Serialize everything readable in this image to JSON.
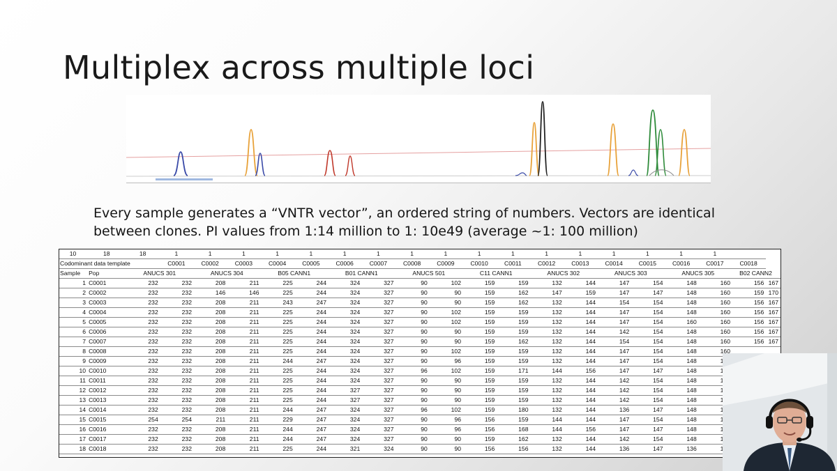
{
  "slide": {
    "title": "Multiplex across multiple loci",
    "text_line1": "Every sample generates a “VNTR vector”, an ordered string of numbers. Vectors are identical",
    "text_line2": "between clones. PI values from 1:14 million to 1: 10e49 (average ~1: 100 million)"
  },
  "electropherogram": {
    "peak_colors": {
      "blue": "#3a4aa8",
      "orange": "#e8a23a",
      "red": "#c0392b",
      "black": "#222222",
      "green": "#2e8b3a"
    }
  },
  "spreadsheet": {
    "row1": [
      "10",
      "18",
      "18",
      "1",
      "1",
      "1",
      "1",
      "1",
      "1",
      "1",
      "1",
      "1",
      "1",
      "1",
      "1",
      "1",
      "1",
      "1",
      "1",
      "1"
    ],
    "template_label": "Codominant data template",
    "template_codes": [
      "C0001",
      "C0002",
      "C0003",
      "C0004",
      "C0005",
      "C0006",
      "C0007",
      "C0008",
      "C0009",
      "C0010",
      "C0011",
      "C0012",
      "C0013",
      "C0014",
      "C0015",
      "C0016",
      "C0017",
      "C0018"
    ],
    "header": {
      "sample": "Sample",
      "pop": "Pop",
      "loci": [
        "ANUCS 301",
        "ANUCS 304",
        "B05 CANN1",
        "B01 CANN1",
        "ANUCS 501",
        "C11 CANN1",
        "ANUCS 302",
        "ANUCS 303",
        "ANUCS 305",
        "B02 CANN2"
      ]
    },
    "rows": [
      {
        "sample": "1",
        "pop": "C0001",
        "values": [
          "232",
          "232",
          "208",
          "211",
          "225",
          "244",
          "324",
          "327",
          "90",
          "102",
          "159",
          "159",
          "132",
          "144",
          "147",
          "154",
          "148",
          "160",
          "156",
          "167"
        ]
      },
      {
        "sample": "2",
        "pop": "C0002",
        "values": [
          "232",
          "232",
          "146",
          "146",
          "225",
          "244",
          "324",
          "327",
          "90",
          "90",
          "159",
          "162",
          "147",
          "159",
          "147",
          "147",
          "148",
          "160",
          "159",
          "170"
        ]
      },
      {
        "sample": "3",
        "pop": "C0003",
        "values": [
          "232",
          "232",
          "208",
          "211",
          "243",
          "247",
          "324",
          "327",
          "90",
          "90",
          "159",
          "162",
          "132",
          "144",
          "154",
          "154",
          "148",
          "160",
          "156",
          "167"
        ]
      },
      {
        "sample": "4",
        "pop": "C0004",
        "values": [
          "232",
          "232",
          "208",
          "211",
          "225",
          "244",
          "324",
          "327",
          "90",
          "102",
          "159",
          "159",
          "132",
          "144",
          "147",
          "154",
          "148",
          "160",
          "156",
          "167"
        ]
      },
      {
        "sample": "5",
        "pop": "C0005",
        "values": [
          "232",
          "232",
          "208",
          "211",
          "225",
          "244",
          "324",
          "327",
          "90",
          "102",
          "159",
          "159",
          "132",
          "144",
          "147",
          "154",
          "160",
          "160",
          "156",
          "167"
        ]
      },
      {
        "sample": "6",
        "pop": "C0006",
        "values": [
          "232",
          "232",
          "208",
          "211",
          "225",
          "244",
          "324",
          "327",
          "90",
          "90",
          "159",
          "159",
          "132",
          "144",
          "142",
          "154",
          "148",
          "160",
          "156",
          "167"
        ]
      },
      {
        "sample": "7",
        "pop": "C0007",
        "values": [
          "232",
          "232",
          "208",
          "211",
          "225",
          "244",
          "324",
          "327",
          "90",
          "90",
          "159",
          "162",
          "132",
          "144",
          "154",
          "154",
          "148",
          "160",
          "156",
          "167"
        ]
      },
      {
        "sample": "8",
        "pop": "C0008",
        "values": [
          "232",
          "232",
          "208",
          "211",
          "225",
          "244",
          "324",
          "327",
          "90",
          "102",
          "159",
          "159",
          "132",
          "144",
          "147",
          "154",
          "148",
          "160",
          "",
          ""
        ]
      },
      {
        "sample": "9",
        "pop": "C0009",
        "values": [
          "232",
          "232",
          "208",
          "211",
          "244",
          "247",
          "324",
          "327",
          "90",
          "96",
          "159",
          "159",
          "132",
          "144",
          "147",
          "154",
          "148",
          "160",
          "",
          ""
        ]
      },
      {
        "sample": "10",
        "pop": "C0010",
        "values": [
          "232",
          "232",
          "208",
          "211",
          "225",
          "244",
          "324",
          "327",
          "96",
          "102",
          "159",
          "171",
          "144",
          "156",
          "147",
          "147",
          "148",
          "160",
          "",
          ""
        ]
      },
      {
        "sample": "11",
        "pop": "C0011",
        "values": [
          "232",
          "232",
          "208",
          "211",
          "225",
          "244",
          "324",
          "327",
          "90",
          "90",
          "159",
          "159",
          "132",
          "144",
          "142",
          "154",
          "148",
          "160",
          "",
          ""
        ]
      },
      {
        "sample": "12",
        "pop": "C0012",
        "values": [
          "232",
          "232",
          "208",
          "211",
          "225",
          "244",
          "327",
          "327",
          "90",
          "90",
          "159",
          "159",
          "132",
          "144",
          "142",
          "154",
          "148",
          "160",
          "",
          ""
        ]
      },
      {
        "sample": "13",
        "pop": "C0013",
        "values": [
          "232",
          "232",
          "208",
          "211",
          "225",
          "244",
          "327",
          "327",
          "90",
          "90",
          "159",
          "159",
          "132",
          "144",
          "142",
          "154",
          "148",
          "160",
          "",
          ""
        ]
      },
      {
        "sample": "14",
        "pop": "C0014",
        "values": [
          "232",
          "232",
          "208",
          "211",
          "244",
          "247",
          "324",
          "327",
          "96",
          "102",
          "159",
          "180",
          "132",
          "144",
          "136",
          "147",
          "148",
          "160",
          "",
          ""
        ]
      },
      {
        "sample": "15",
        "pop": "C0015",
        "values": [
          "254",
          "254",
          "211",
          "211",
          "229",
          "247",
          "324",
          "327",
          "90",
          "96",
          "156",
          "159",
          "144",
          "144",
          "147",
          "154",
          "148",
          "160",
          "",
          ""
        ]
      },
      {
        "sample": "16",
        "pop": "C0016",
        "values": [
          "232",
          "232",
          "208",
          "211",
          "244",
          "247",
          "324",
          "327",
          "90",
          "96",
          "156",
          "168",
          "144",
          "156",
          "147",
          "147",
          "148",
          "160",
          "",
          ""
        ]
      },
      {
        "sample": "17",
        "pop": "C0017",
        "values": [
          "232",
          "232",
          "208",
          "211",
          "244",
          "247",
          "324",
          "327",
          "90",
          "90",
          "159",
          "162",
          "132",
          "144",
          "142",
          "154",
          "148",
          "160",
          "",
          ""
        ]
      },
      {
        "sample": "18",
        "pop": "C0018",
        "values": [
          "232",
          "232",
          "208",
          "211",
          "225",
          "244",
          "321",
          "324",
          "90",
          "90",
          "156",
          "156",
          "132",
          "144",
          "136",
          "147",
          "136",
          "148",
          "",
          ""
        ]
      }
    ]
  },
  "webcam": {
    "description_icon": "presenter-video-icon"
  }
}
